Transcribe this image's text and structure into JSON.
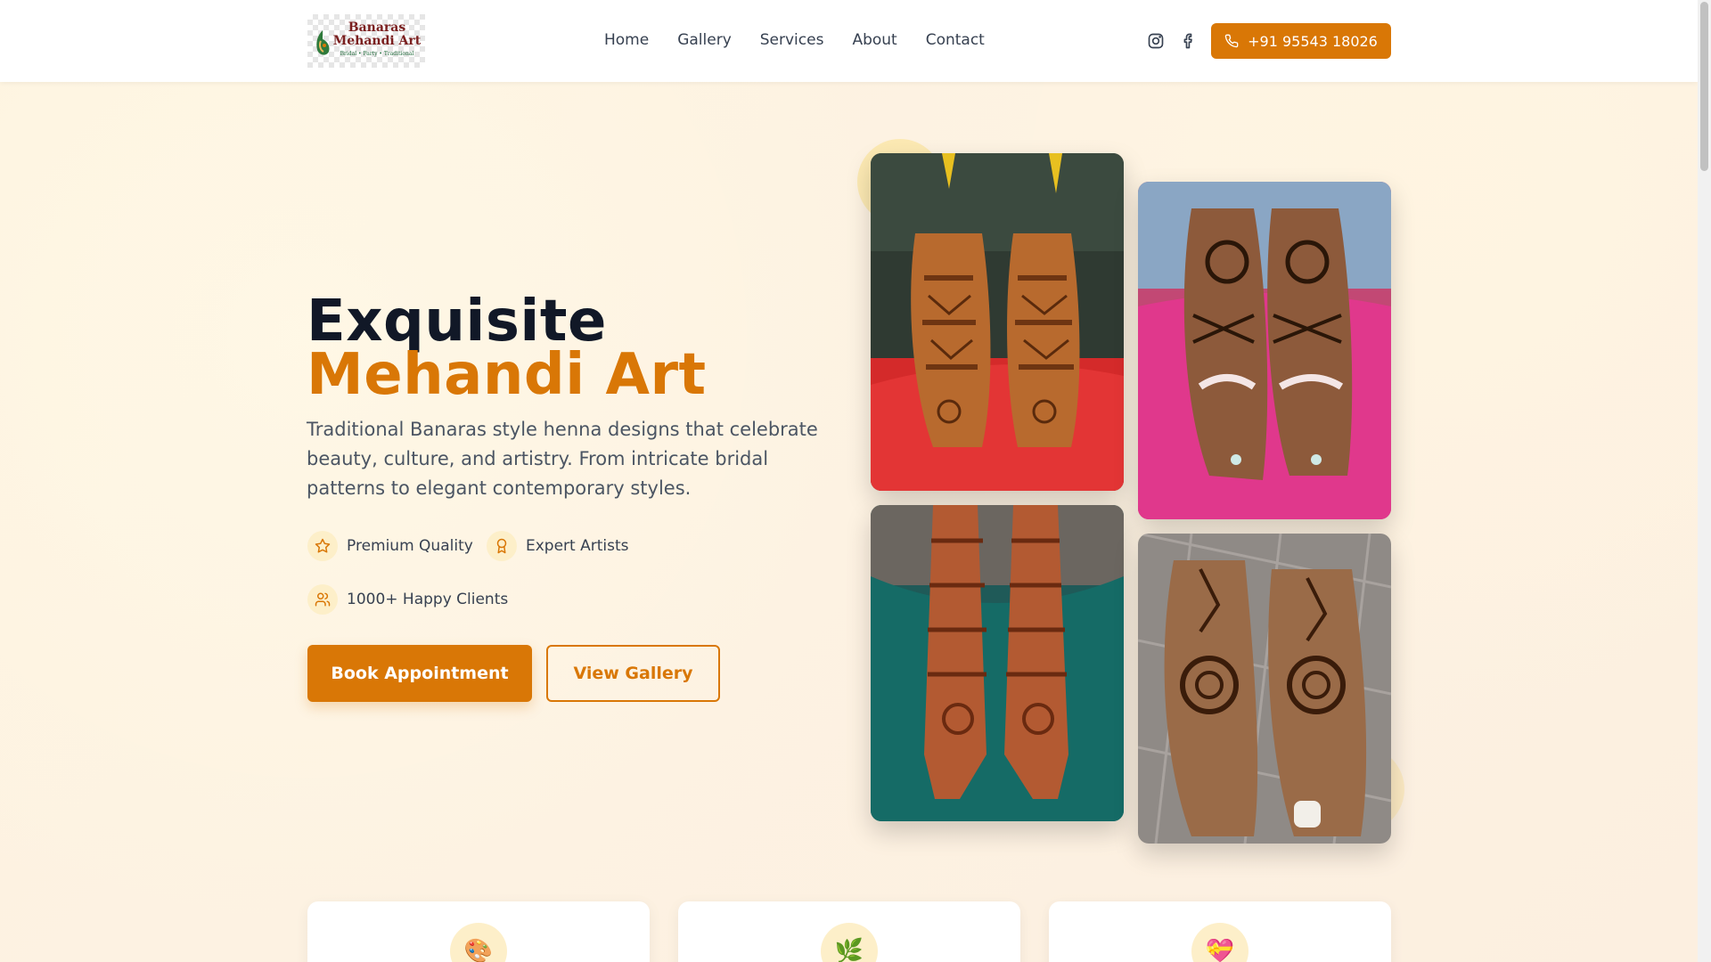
{
  "brand": {
    "logo_line1": "Banaras",
    "logo_line2": "Mehandi Art",
    "logo_line3": "Bridal • Party • Traditional"
  },
  "nav": {
    "items": [
      "Home",
      "Gallery",
      "Services",
      "About",
      "Contact"
    ]
  },
  "header": {
    "phone_label": "+91 95543 18026",
    "social_icons": [
      "instagram-icon",
      "facebook-icon"
    ]
  },
  "hero": {
    "title_line1": "Exquisite",
    "title_line2": "Mehandi Art",
    "description": "Traditional Banaras style henna designs that celebrate beauty, culture, and artistry. From intricate bridal patterns to elegant contemporary styles.",
    "features": [
      {
        "icon": "star-icon",
        "label": "Premium Quality"
      },
      {
        "icon": "award-icon",
        "label": "Expert Artists"
      },
      {
        "icon": "users-icon",
        "label": "1000+ Happy Clients"
      }
    ],
    "primary_button": "Book Appointment",
    "secondary_button": "View Gallery"
  },
  "gallery": {
    "photos": [
      {
        "subject": "bridal feet mehandi on red cloth"
      },
      {
        "subject": "feet mehandi on pink cloth"
      },
      {
        "subject": "bridal hands mehandi on green dress"
      },
      {
        "subject": "feet mehandi on tiled floor"
      }
    ]
  },
  "cards": [
    {
      "icon": "palette-icon",
      "glyph": "🎨"
    },
    {
      "icon": "leaf-icon",
      "glyph": "🌿"
    },
    {
      "icon": "heart-icon",
      "glyph": "💝"
    }
  ],
  "colors": {
    "accent": "#d97706",
    "dark_text": "#111827",
    "icon_bg": "#fdefc9",
    "page_bg": "#fdf4e3"
  }
}
